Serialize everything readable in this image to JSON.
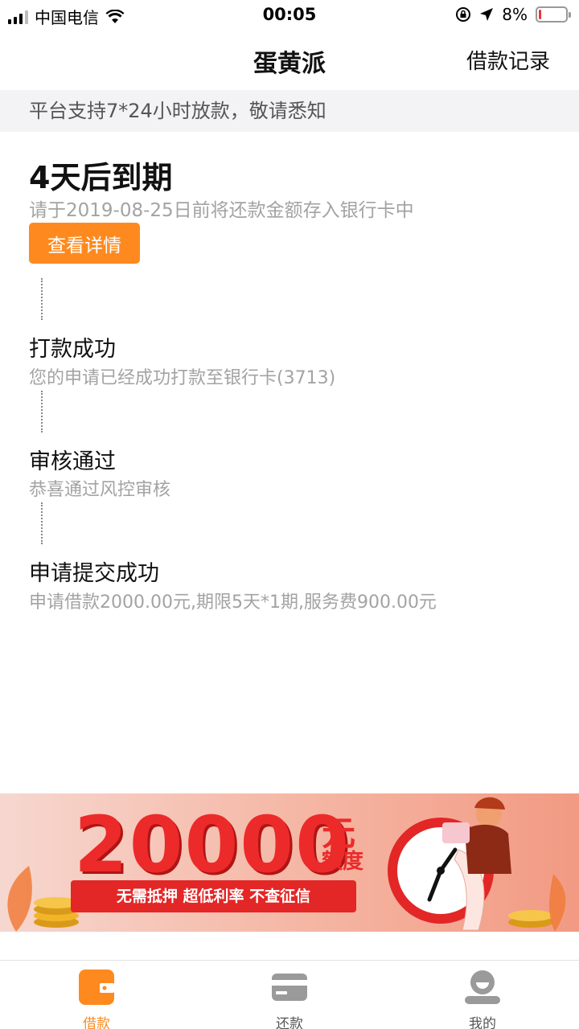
{
  "status_bar": {
    "carrier": "中国电信",
    "time": "00:05",
    "battery": "8%",
    "battery_level": 0.08
  },
  "nav": {
    "title": "蛋黄派",
    "right_link": "借款记录"
  },
  "notice": "平台支持7*24小时放款，敬请悉知",
  "due": {
    "title": "4天后到期",
    "desc": "请于2019-08-25日前将还款金额存入银行卡中",
    "button": "查看详情"
  },
  "steps": [
    {
      "title": "打款成功",
      "desc": "您的申请已经成功打款至银行卡(3713)"
    },
    {
      "title": "审核通过",
      "desc": "恭喜通过风控审核"
    },
    {
      "title": "申请提交成功",
      "desc": "申请借款2000.00元,期限5天*1期,服务费900.00元"
    }
  ],
  "banner": {
    "amount": "20000",
    "unit": "元",
    "quota": "额度",
    "slogan": "无需抵押 超低利率 不查征信"
  },
  "tabs": [
    {
      "label": "借款",
      "icon": "wallet-icon",
      "active": true
    },
    {
      "label": "还款",
      "icon": "card-icon",
      "active": false
    },
    {
      "label": "我的",
      "icon": "user-icon",
      "active": false
    }
  ],
  "colors": {
    "accent": "#fe8a1f",
    "banner_red": "#ec2a2a",
    "muted_text": "#a3a3a3"
  }
}
